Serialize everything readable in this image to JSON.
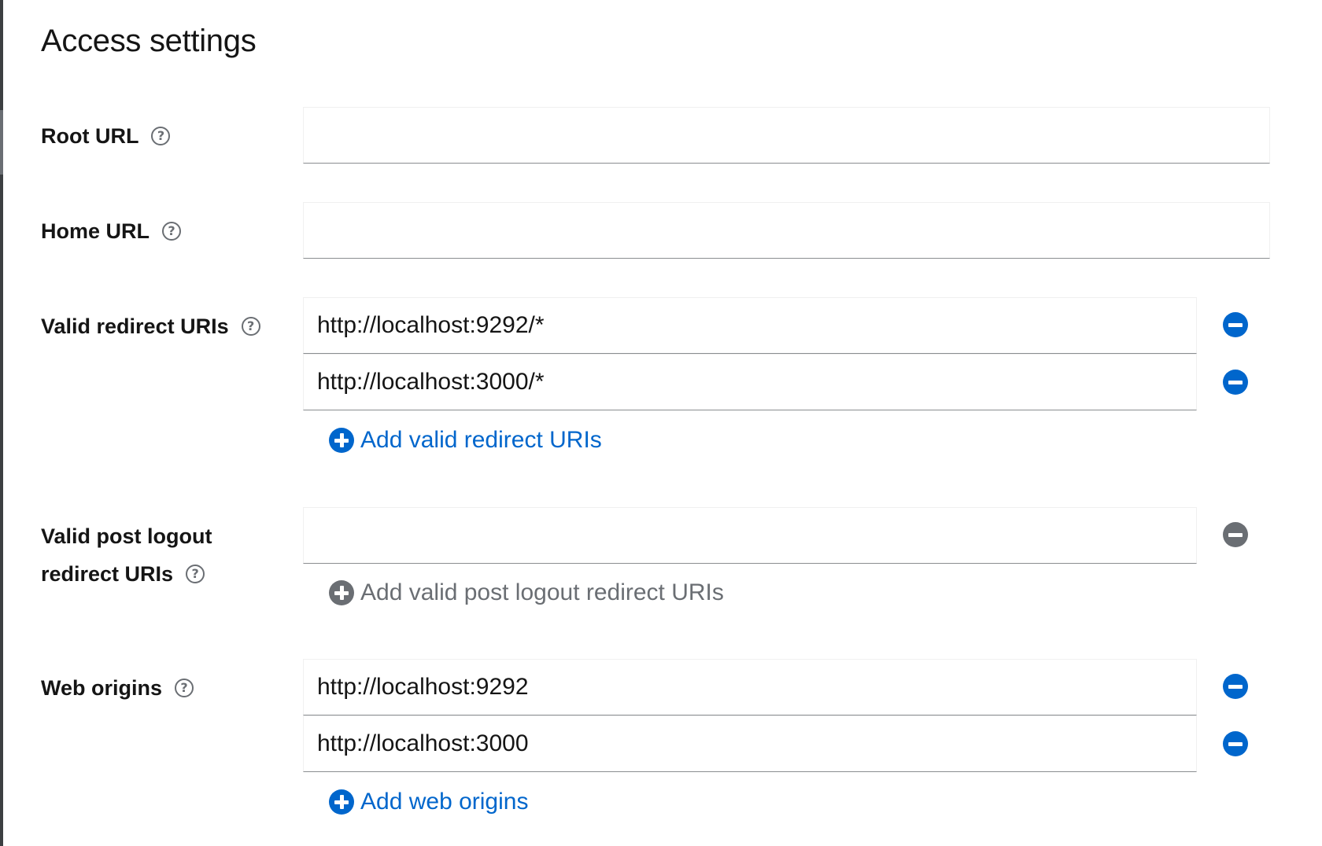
{
  "section_title": "Access settings",
  "root_url": {
    "label": "Root URL",
    "value": ""
  },
  "home_url": {
    "label": "Home URL",
    "value": ""
  },
  "valid_redirect_uris": {
    "label": "Valid redirect URIs",
    "values": [
      "http://localhost:9292/*",
      "http://localhost:3000/*"
    ],
    "add_label": "Add valid redirect URIs"
  },
  "valid_post_logout": {
    "label_line1": "Valid post logout",
    "label_line2": "redirect URIs",
    "values": [
      ""
    ],
    "add_label": "Add valid post logout redirect URIs"
  },
  "web_origins": {
    "label": "Web origins",
    "values": [
      "http://localhost:9292",
      "http://localhost:3000"
    ],
    "add_label": "Add web origins"
  },
  "colors": {
    "link": "#0066cc",
    "disabled": "#6a6e73",
    "text": "#151515"
  },
  "icons": {
    "help": "help-icon",
    "remove": "minus-circle-icon",
    "add": "plus-circle-icon"
  }
}
